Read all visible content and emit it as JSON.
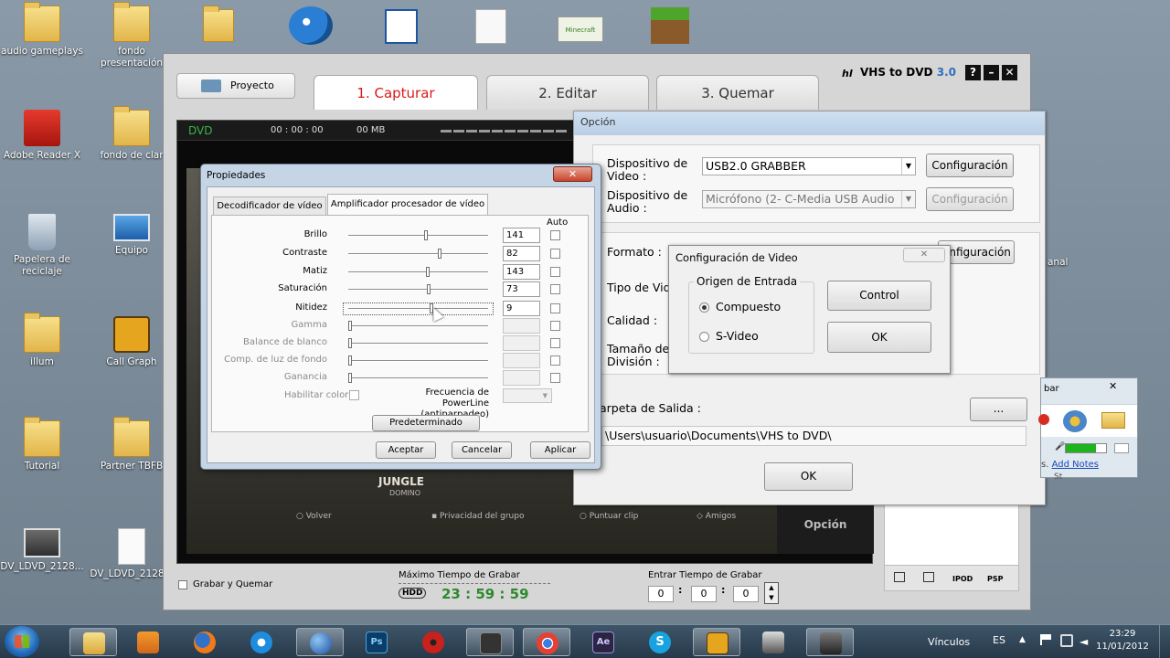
{
  "desktop": {
    "icons": [
      {
        "label": "audio gameplays"
      },
      {
        "label": "fondo presentación"
      },
      {
        "label": "Adobe Reader X"
      },
      {
        "label": "fondo de clar"
      },
      {
        "label": "Papelera de reciclaje"
      },
      {
        "label": "Equipo"
      },
      {
        "label": "illum"
      },
      {
        "label": "Call Graph"
      },
      {
        "label": "Tutorial"
      },
      {
        "label": "Partner TBFB"
      },
      {
        "label": "DV_LDVD_2128..."
      },
      {
        "label": "DV_LDVD_2128..."
      }
    ],
    "right_fragment": "anal"
  },
  "vhs": {
    "title": "VHS to DVD",
    "version": "3.0",
    "project_tab": "Proyecto",
    "tabs": [
      "1. Capturar",
      "2. Editar",
      "3. Quemar"
    ],
    "player": {
      "format": "DVD",
      "time": "00 : 00 : 00",
      "size": "00 MB",
      "menu_title": "JUNGLE",
      "menu_sub": "DOMINO",
      "menu_items": [
        "Volver",
        "Privacidad del grupo",
        "Puntuar clip",
        "Amigos"
      ]
    },
    "option_button": "Opción",
    "burn_check": "Grabar y Quemar",
    "max_time_label": "Máximo Tiempo de Grabar",
    "hdd": "HDD",
    "max_time": "23 : 59 : 59",
    "enter_time_label": "Entrar Tiempo de Grabar",
    "enter_h": "0",
    "enter_m": "0",
    "enter_s": "0",
    "bottom_icons": [
      "IPOD",
      "PSP"
    ]
  },
  "opcion": {
    "title": "Opción",
    "video_device_label": "Dispositivo de Video :",
    "video_device": "USB2.0 GRABBER",
    "audio_device_label": "Dispositivo de Audio :",
    "audio_device": "Micrófono (2- C-Media USB Audio",
    "config_btn": "Configuración",
    "config_btn_fragment": "onfiguración",
    "format_label": "Formato :",
    "type_label": "Tipo de Vid",
    "quality_label": "Calidad :",
    "size_label": "Tamaño de División :",
    "output_label": "arpeta de Salida :",
    "browse": "...",
    "output_path": "\\Users\\usuario\\Documents\\VHS to DVD\\",
    "ok": "OK"
  },
  "propiedades": {
    "title": "Propiedades",
    "tabs": [
      "Decodificador de vídeo",
      "Amplificador procesador de vídeo"
    ],
    "auto_label": "Auto",
    "rows": [
      {
        "label": "Brillo",
        "value": "141",
        "pos": 0.56,
        "enabled": true
      },
      {
        "label": "Contraste",
        "value": "82",
        "pos": 0.66,
        "enabled": true
      },
      {
        "label": "Matiz",
        "value": "143",
        "pos": 0.57,
        "enabled": true
      },
      {
        "label": "Saturación",
        "value": "73",
        "pos": 0.58,
        "enabled": true
      },
      {
        "label": "Nitidez",
        "value": "9",
        "pos": 0.6,
        "enabled": true
      },
      {
        "label": "Gamma",
        "value": "",
        "pos": 0.0,
        "enabled": false
      },
      {
        "label": "Balance de blanco",
        "value": "",
        "pos": 0.0,
        "enabled": false
      },
      {
        "label": "Comp. de luz de fondo",
        "value": "",
        "pos": 0.0,
        "enabled": false
      },
      {
        "label": "Ganancia",
        "value": "",
        "pos": 0.0,
        "enabled": false
      }
    ],
    "color_enable": "Habilitar color",
    "powerline": "Frecuencia de PowerLine",
    "powerline_sub": "(antiparpadeo)",
    "default_btn": "Predeterminado",
    "accept": "Aceptar",
    "cancel": "Cancelar",
    "apply": "Aplicar"
  },
  "cfgvideo": {
    "title": "Configuración de Video",
    "group": "Origen de Entrada",
    "composite": "Compuesto",
    "svideo": "S-Video",
    "control": "Control",
    "ok": "OK"
  },
  "recorder": {
    "title_fragment": "bar",
    "notes_prefix": "s.",
    "notes_link": "Add Notes",
    "fragment": "St"
  },
  "taskbar": {
    "links": "Vínculos",
    "lang": "ES",
    "time": "23:29",
    "date": "11/01/2012",
    "apps": [
      "explorer",
      "media",
      "firefox",
      "ie",
      "globe",
      "photoshop",
      "ladybug",
      "app",
      "chrome",
      "aftereffects",
      "skype",
      "callgraph",
      "scanner",
      "camcorder"
    ]
  }
}
